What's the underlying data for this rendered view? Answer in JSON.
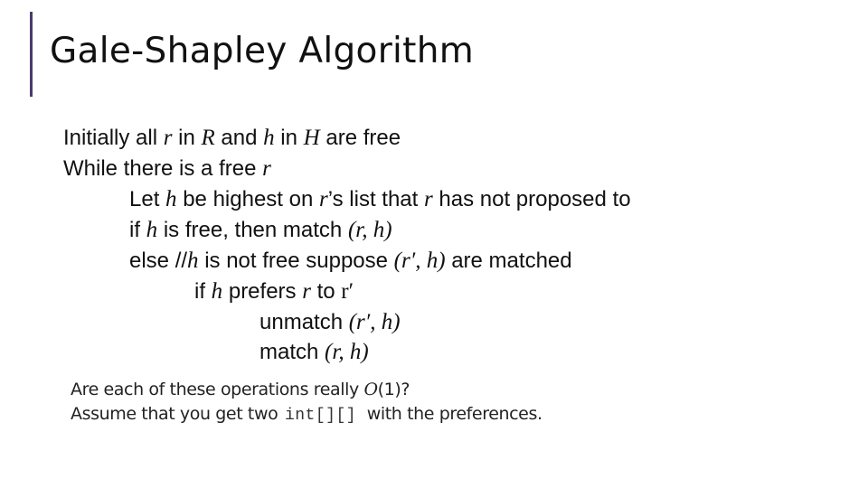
{
  "slide": {
    "title": "Gale-Shapley Algorithm",
    "accent_color": "#4a3a6c"
  },
  "algorithm": {
    "line0": {
      "t1": "Initially all ",
      "v1": "r",
      "t2": " in ",
      "v2": "R",
      "t3": " and ",
      "v3": "h",
      "t4": " in ",
      "v4": "H",
      "t5": " are free"
    },
    "line1": {
      "t1": "While there is a free ",
      "v1": "r"
    },
    "line2": {
      "t1": "Let ",
      "v1": "h",
      "t2": " be highest on ",
      "v2": "r",
      "t3": "’s list that ",
      "v3": "r",
      "t4": " has not proposed to"
    },
    "line3": {
      "t1": "if ",
      "v1": "h",
      "t2": " is free, then match ",
      "v2": "(r, h)"
    },
    "line4": {
      "t1": "else //",
      "v1": "h",
      "t2": " is not free suppose ",
      "v2": "(r′, h)",
      "t3": " are matched"
    },
    "line5": {
      "t1": "if ",
      "v1": "h",
      "t2": " prefers ",
      "v2": "r",
      "t3": " to ",
      "v3": "r′"
    },
    "line6": {
      "t1": "unmatch ",
      "v1": "(r′, h)"
    },
    "line7": {
      "t1": "match ",
      "v1": "(r, h)"
    }
  },
  "notes": {
    "line1": {
      "t1": "Are each of these operations really ",
      "v1": "O",
      "t2": "(1)?"
    },
    "line2": {
      "t1": "Assume that you get two ",
      "code": "int[][]",
      "t2": " with the preferences."
    }
  }
}
